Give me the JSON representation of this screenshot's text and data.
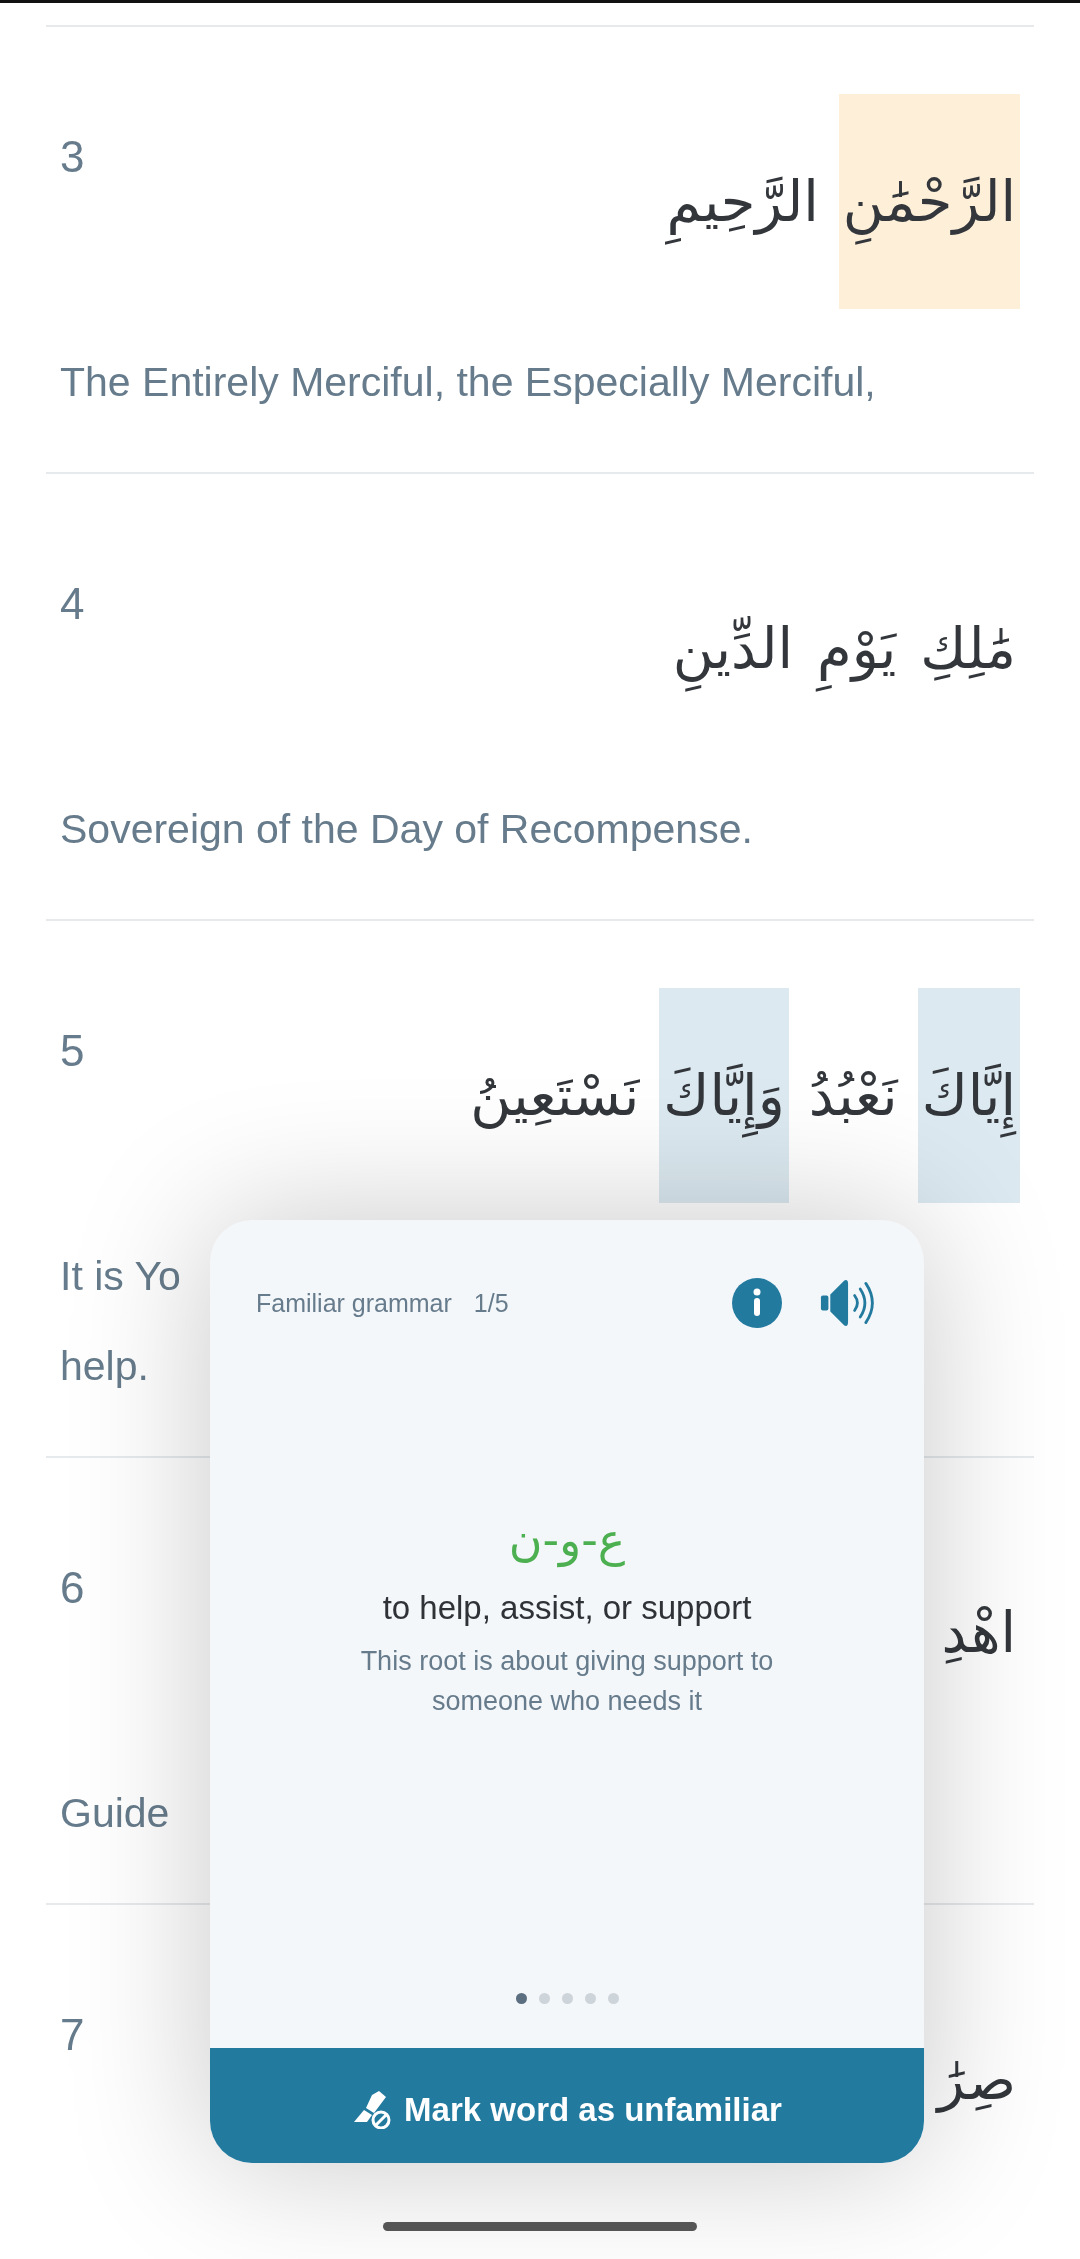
{
  "verses": [
    {
      "number": "3",
      "words": [
        {
          "text": "الرَّحْمَٰنِ",
          "color": "#feefd9"
        },
        {
          "text": "الرَّحِيمِ"
        }
      ],
      "translation": [
        "The Entirely Merciful, the Especially Merciful,"
      ]
    },
    {
      "number": "4",
      "words": [
        {
          "text": "مَٰلِكِ"
        },
        {
          "text": "يَوْمِ"
        },
        {
          "text": "الدِّينِ"
        }
      ],
      "translation": [
        "Sovereign of the Day of Recompense."
      ]
    },
    {
      "number": "5",
      "words": [
        {
          "text": "إِيَّاكَ",
          "color": "#dce9f0"
        },
        {
          "text": "نَعْبُدُ"
        },
        {
          "text": "وَإِيَّاكَ",
          "color": "#dce9f0"
        },
        {
          "text": "نَسْتَعِينُ"
        }
      ],
      "translation": [
        "It is Yo",
        "help."
      ]
    },
    {
      "number": "6",
      "words": [
        {
          "text": "اهْدِ"
        }
      ],
      "translation": [
        "Guide"
      ]
    },
    {
      "number": "7",
      "words": [
        {
          "text": "صِرَٰ"
        }
      ]
    }
  ],
  "popup": {
    "title": "Familiar grammar",
    "counter": "1/5",
    "root": "ع-و-ن",
    "meaning": "to help, assist, or support",
    "description": "This root is about giving support to someone who needs it",
    "pages": [
      {
        "selected": true
      },
      {
        "selected": false
      },
      {
        "selected": false
      },
      {
        "selected": false
      },
      {
        "selected": false
      }
    ],
    "action": {
      "label": "Mark word as unfamiliar"
    }
  }
}
